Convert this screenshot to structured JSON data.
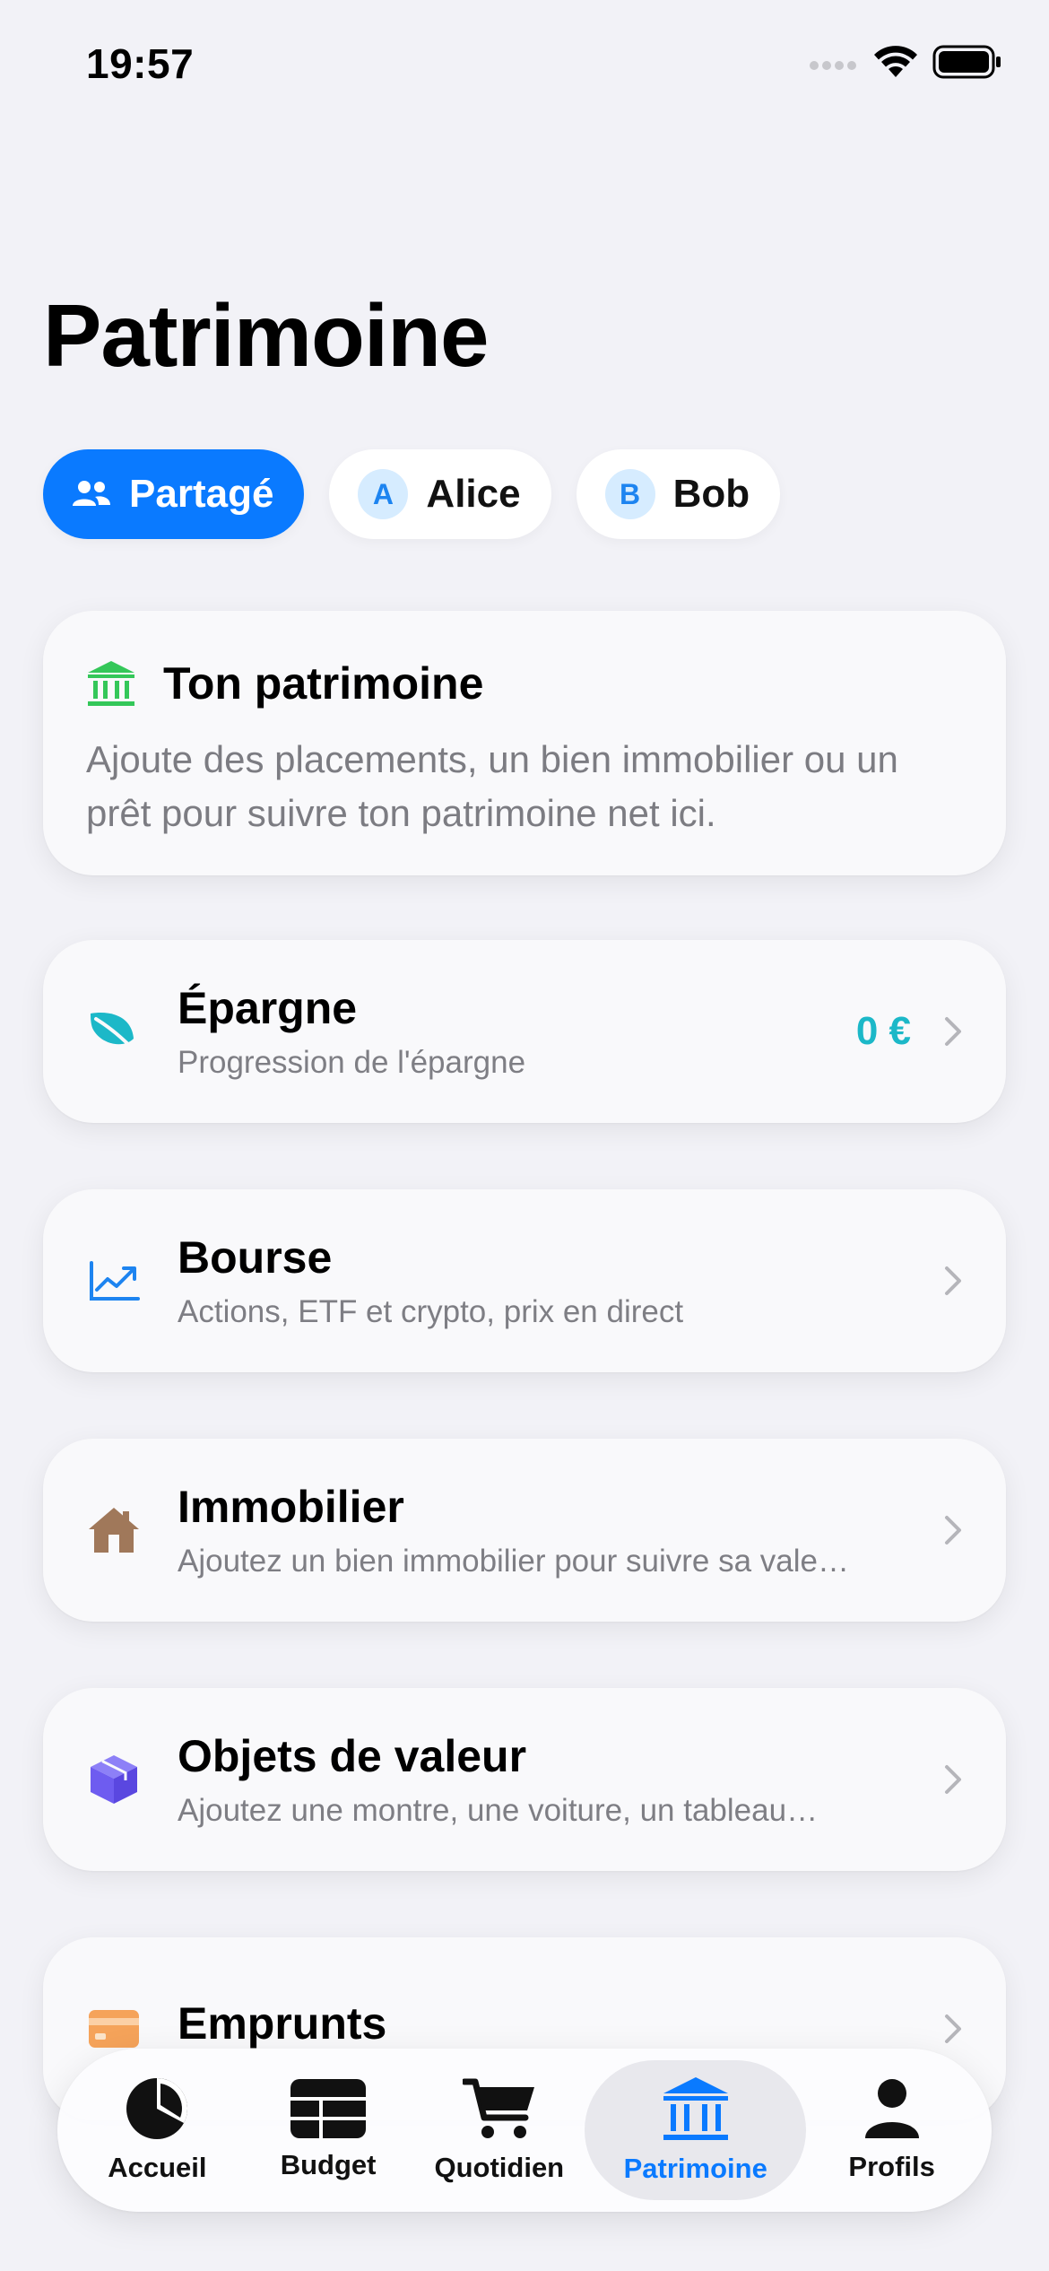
{
  "status_bar": {
    "time": "19:57"
  },
  "page": {
    "title": "Patrimoine"
  },
  "segments": [
    {
      "label": "Partagé",
      "icon": "people-icon",
      "active": true
    },
    {
      "label": "Alice",
      "badge": "A",
      "active": false
    },
    {
      "label": "Bob",
      "badge": "B",
      "active": false
    }
  ],
  "intro": {
    "title": "Ton patrimoine",
    "text": "Ajoute des placements, un bien immobilier ou un prêt pour suivre ton patrimoine net ici.",
    "icon": "bank-icon"
  },
  "rows": [
    {
      "title": "Épargne",
      "subtitle": "Progression de l'épargne",
      "value": "0 €",
      "icon": "leaf-icon",
      "color": "#1cb8c8"
    },
    {
      "title": "Bourse",
      "subtitle": "Actions, ETF et crypto, prix en direct",
      "icon": "chart-up-icon",
      "color": "#1d84f0"
    },
    {
      "title": "Immobilier",
      "subtitle": "Ajoutez un bien immobilier pour suivre sa valeur et ses revenus",
      "icon": "house-icon",
      "color": "#a0785a"
    },
    {
      "title": "Objets de valeur",
      "subtitle": "Ajoutez une montre, une voiture, un tableau…",
      "icon": "cube-icon",
      "color": "#6e5cf0"
    },
    {
      "title": "Emprunts",
      "subtitle": "",
      "icon": "card-icon",
      "color": "#f5a35a"
    }
  ],
  "tabs": [
    {
      "label": "Accueil",
      "icon": "pie-chart-icon",
      "active": false
    },
    {
      "label": "Budget",
      "icon": "grid-icon",
      "active": false
    },
    {
      "label": "Quotidien",
      "icon": "cart-icon",
      "active": false
    },
    {
      "label": "Patrimoine",
      "icon": "bank-icon",
      "active": true
    },
    {
      "label": "Profils",
      "icon": "person-icon",
      "active": false
    }
  ],
  "colors": {
    "accent": "#0a7aff",
    "background": "#f2f2f7",
    "epargne_value": "#1cb8c8"
  }
}
